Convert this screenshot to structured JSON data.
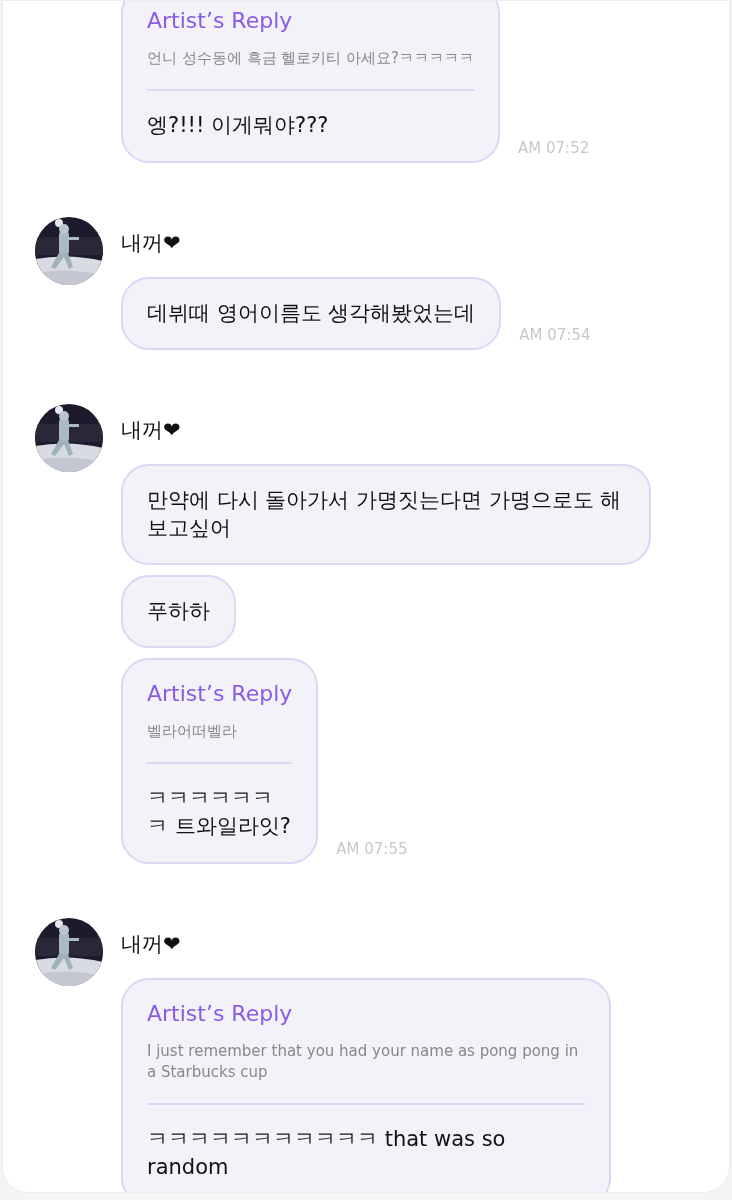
{
  "groups": [
    {
      "messages": [
        {
          "kind": "reply",
          "reply_title": "Artist’s Reply",
          "quote": "언니 성수동에 흑금 헬로키티 아세요?ㅋㅋㅋㅋㅋ",
          "text": "엥?!!! 이게뭐야???"
        }
      ],
      "time": "AM 07:52"
    },
    {
      "sender": "내꺼❤",
      "avatar": {
        "kind": "picture"
      },
      "messages": [
        {
          "kind": "text",
          "text": "데뷔때 영어이름도 생각해봤었는데"
        }
      ],
      "time": "AM 07:54"
    },
    {
      "sender": "내꺼❤",
      "avatar": {
        "kind": "picture"
      },
      "messages": [
        {
          "kind": "text",
          "text": "만약에 다시 돌아가서 가명짓는다면 가명으로도 해보고싶어"
        },
        {
          "kind": "text",
          "text": "푸하하"
        },
        {
          "kind": "reply",
          "reply_title": "Artist’s Reply",
          "quote": "벨라어떠벨라",
          "text": "ㅋㅋㅋㅋㅋㅋㅋ 트와일라잇?"
        }
      ],
      "time": "AM 07:55"
    },
    {
      "sender": "내꺼❤",
      "avatar": {
        "kind": "picture"
      },
      "messages": [
        {
          "kind": "reply",
          "reply_title": "Artist’s Reply",
          "quote": "I just remember that you had your name as pong pong in a Starbucks cup",
          "text": "ㅋㅋㅋㅋㅋㅋㅋㅋㅋㅋㅋ that was so random"
        }
      ]
    }
  ]
}
